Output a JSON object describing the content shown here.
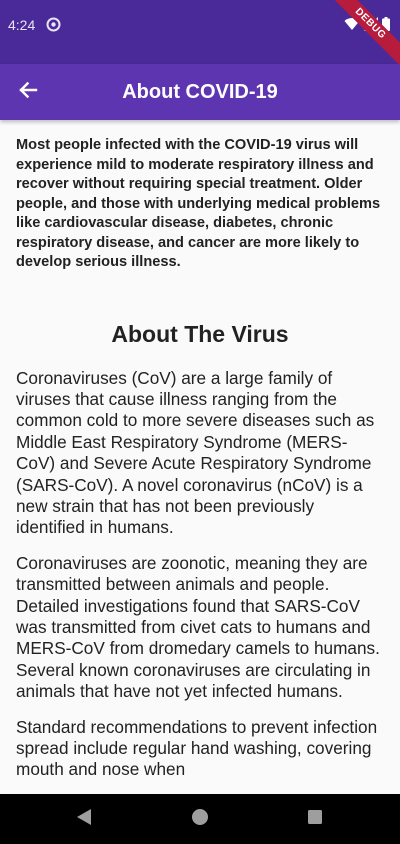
{
  "status_bar": {
    "time": "4:24",
    "debug_label": "DEBUG",
    "icons": [
      "app-status-icon",
      "wifi-icon",
      "signal-icon",
      "battery-icon"
    ]
  },
  "app_bar": {
    "title": "About COVID-19",
    "back_icon": "arrow-left-icon"
  },
  "content": {
    "intro": "Most people infected with the COVID-19 virus will experience mild to moderate respiratory illness and recover without requiring special treatment. Older people, and those with underlying medical problems like cardiovascular disease, diabetes, chronic respiratory disease, and cancer are more likely to develop serious illness.",
    "section_title": "About The Virus",
    "paragraphs": [
      "Coronaviruses (CoV) are a large family of viruses that cause illness ranging from the common cold to more severe diseases such as Middle East Respiratory Syndrome (MERS-CoV) and Severe Acute Respiratory Syndrome (SARS-CoV). A novel coronavirus (nCoV) is a new strain that has not been previously identified in humans.",
      "Coronaviruses are zoonotic, meaning they are transmitted between animals and people. Detailed investigations found that SARS-CoV was transmitted from civet cats to humans and MERS-CoV from dromedary camels to humans. Several known coronaviruses are circulating in animals that have not yet infected humans.",
      "Standard recommendations to prevent infection spread include regular hand washing, covering mouth and nose when"
    ]
  },
  "nav_bar": {
    "buttons": [
      "back-triangle-icon",
      "home-circle-icon",
      "recents-square-icon"
    ]
  },
  "colors": {
    "status_bar": "#4a2a98",
    "app_bar": "#5e35b1",
    "background": "#fafafa",
    "text": "#222222",
    "debug_banner": "#b71c3c",
    "nav_bar": "#000000"
  }
}
